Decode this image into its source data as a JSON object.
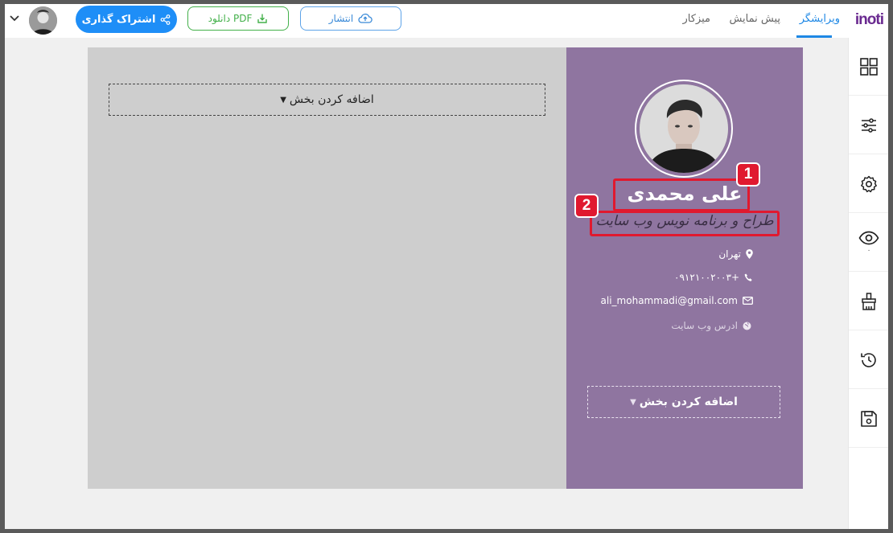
{
  "header": {
    "brand": "inoti",
    "tabs": [
      {
        "label": "ویرایشگر",
        "active": true
      },
      {
        "label": "پیش نمایش",
        "active": false
      },
      {
        "label": "میزکار",
        "active": false
      }
    ],
    "publish_label": "انتشار",
    "pdf_label": "دانلود PDF",
    "share_label": "اشتراک گذاری"
  },
  "sidebar": {
    "items": [
      {
        "icon": "layout-grid-icon"
      },
      {
        "icon": "sliders-icon"
      },
      {
        "icon": "gear-icon"
      },
      {
        "icon": "eye-icon",
        "count": "۰"
      },
      {
        "icon": "brush-icon"
      },
      {
        "icon": "history-icon"
      },
      {
        "icon": "save-icon"
      }
    ]
  },
  "resume": {
    "add_section_label": "اضافه کردن بخش",
    "name": "علی محمدی",
    "job_title": "طراح و برنامه نویس وب سایت",
    "city": "تهران",
    "phone": "+۰۹۱۲۱۰۰۲۰۰۳",
    "email": "ali_mohammadi@gmail.com",
    "website_placeholder": "ادرس وب سایت"
  },
  "callouts": [
    "1",
    "2"
  ],
  "colors": {
    "accent": "#1e8ef7",
    "sidebar_bg": "#8f75a0",
    "callout": "#e0192f",
    "pdf_green": "#43b04a"
  }
}
